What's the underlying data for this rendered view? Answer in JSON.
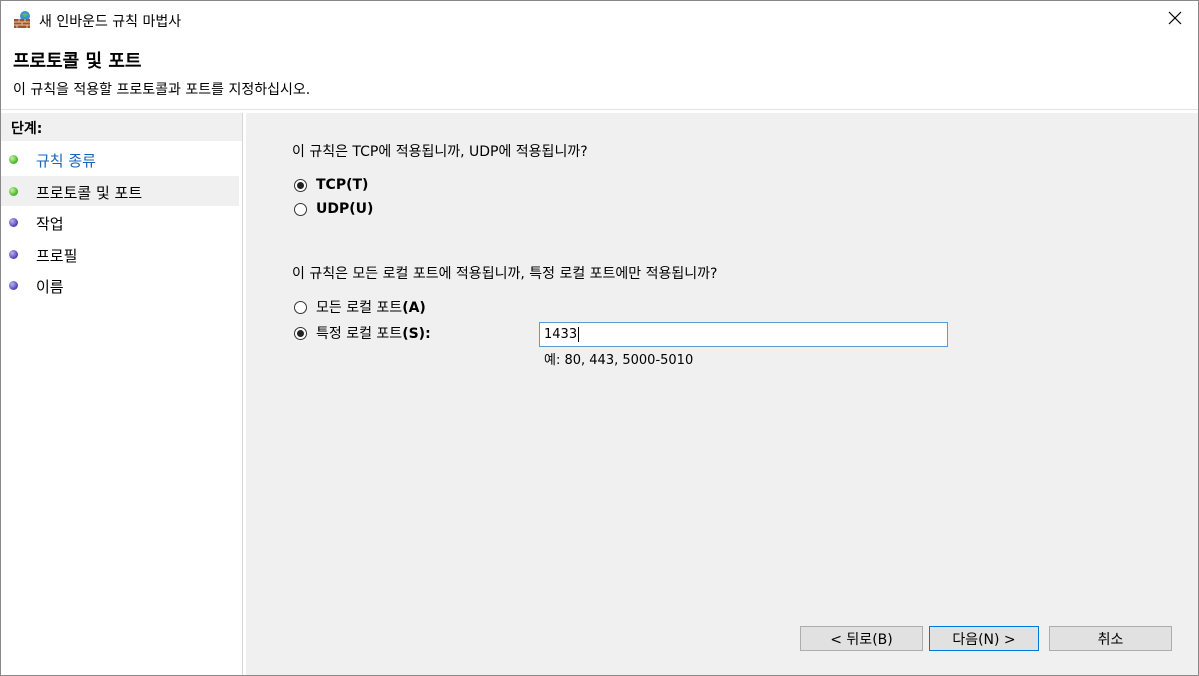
{
  "window": {
    "title": "새 인바운드 규칙 마법사",
    "icons": {
      "app": "firewall-wall-icon",
      "close": "close-icon"
    }
  },
  "header": {
    "title": "프로토콜 및 포트",
    "description": "이 규칙을 적용할 프로토콜과 포트를 지정하십시오."
  },
  "steps": {
    "title": "단계:",
    "items": [
      {
        "label": "규칙 종류",
        "state": "completed",
        "color": "#3fb21f"
      },
      {
        "label": "프로토콜 및 포트",
        "state": "current",
        "color": "#3fb21f"
      },
      {
        "label": "작업",
        "state": "pending",
        "color": "#4c3fb3"
      },
      {
        "label": "프로필",
        "state": "pending",
        "color": "#4c3fb3"
      },
      {
        "label": "이름",
        "state": "pending",
        "color": "#4c3fb3"
      }
    ]
  },
  "protocol": {
    "question": "이 규칙은 TCP에 적용됩니까, UDP에 적용됩니까?",
    "options": [
      {
        "label": "TCP(T)",
        "checked": true
      },
      {
        "label": "UDP(U)",
        "checked": false
      }
    ]
  },
  "ports": {
    "question": "이 규칙은 모든 로컬 포트에 적용됩니까, 특정 로컬 포트에만 적용됩니까?",
    "options": [
      {
        "label_prefix": "모든 로컬 포트",
        "label_suffix": "(A)",
        "checked": false
      },
      {
        "label_prefix": "특정 로컬 포트",
        "label_suffix": "(S):",
        "checked": true
      }
    ],
    "value": "1433",
    "example": "예: 80, 443, 5000-5010"
  },
  "buttons": {
    "back": "< 뒤로(B)",
    "next": "다음(N) >",
    "cancel": "취소"
  },
  "colors": {
    "link": "#1a64b4",
    "accent": "#0078d7",
    "pane": "#f0f0f0"
  }
}
